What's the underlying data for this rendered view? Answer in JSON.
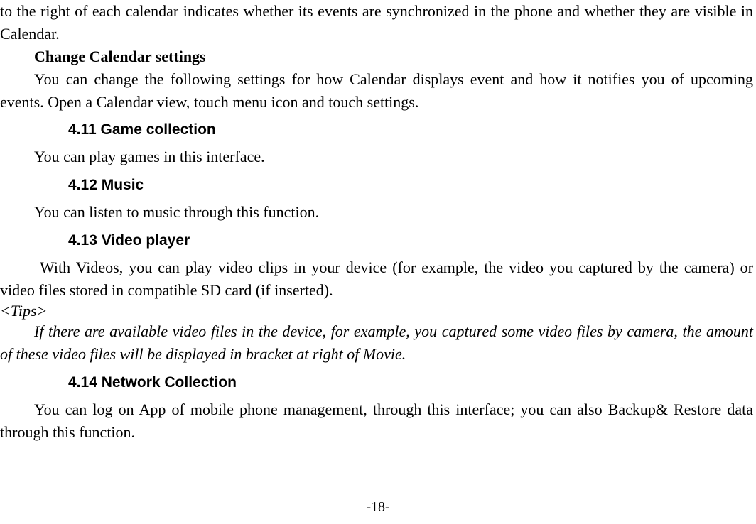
{
  "intro_paragraph": "to the right of each calendar indicates whether its events are synchronized in the phone and whether they are visible in Calendar.",
  "change_heading": "Change Calendar settings",
  "change_body": "You can change the following settings for how Calendar displays event and how it notifies you of upcoming events. Open a Calendar view, touch menu icon and touch settings.",
  "sec_411": "4.11   Game collection",
  "body_411": " You can play games in this interface.",
  "sec_412": "4.12   Music",
  "body_412": "You can listen to music through this function.",
  "sec_413": "4.13   Video player",
  "body_413": "  With Videos, you can play video clips in your device (for example, the video you captured by the camera) or video files stored in compatible SD card (if inserted).",
  "tips_label": "<Tips>",
  "tips_body": "If there are available video files in the device, for example, you captured some video files by camera, the amount of these video files will be displayed in bracket at right of Movie.",
  "sec_414": "4.14   Network Collection",
  "body_414": "You can log on App of mobile phone management, through this interface; you can also Backup& Restore data through this function.",
  "page_number": "-18-"
}
